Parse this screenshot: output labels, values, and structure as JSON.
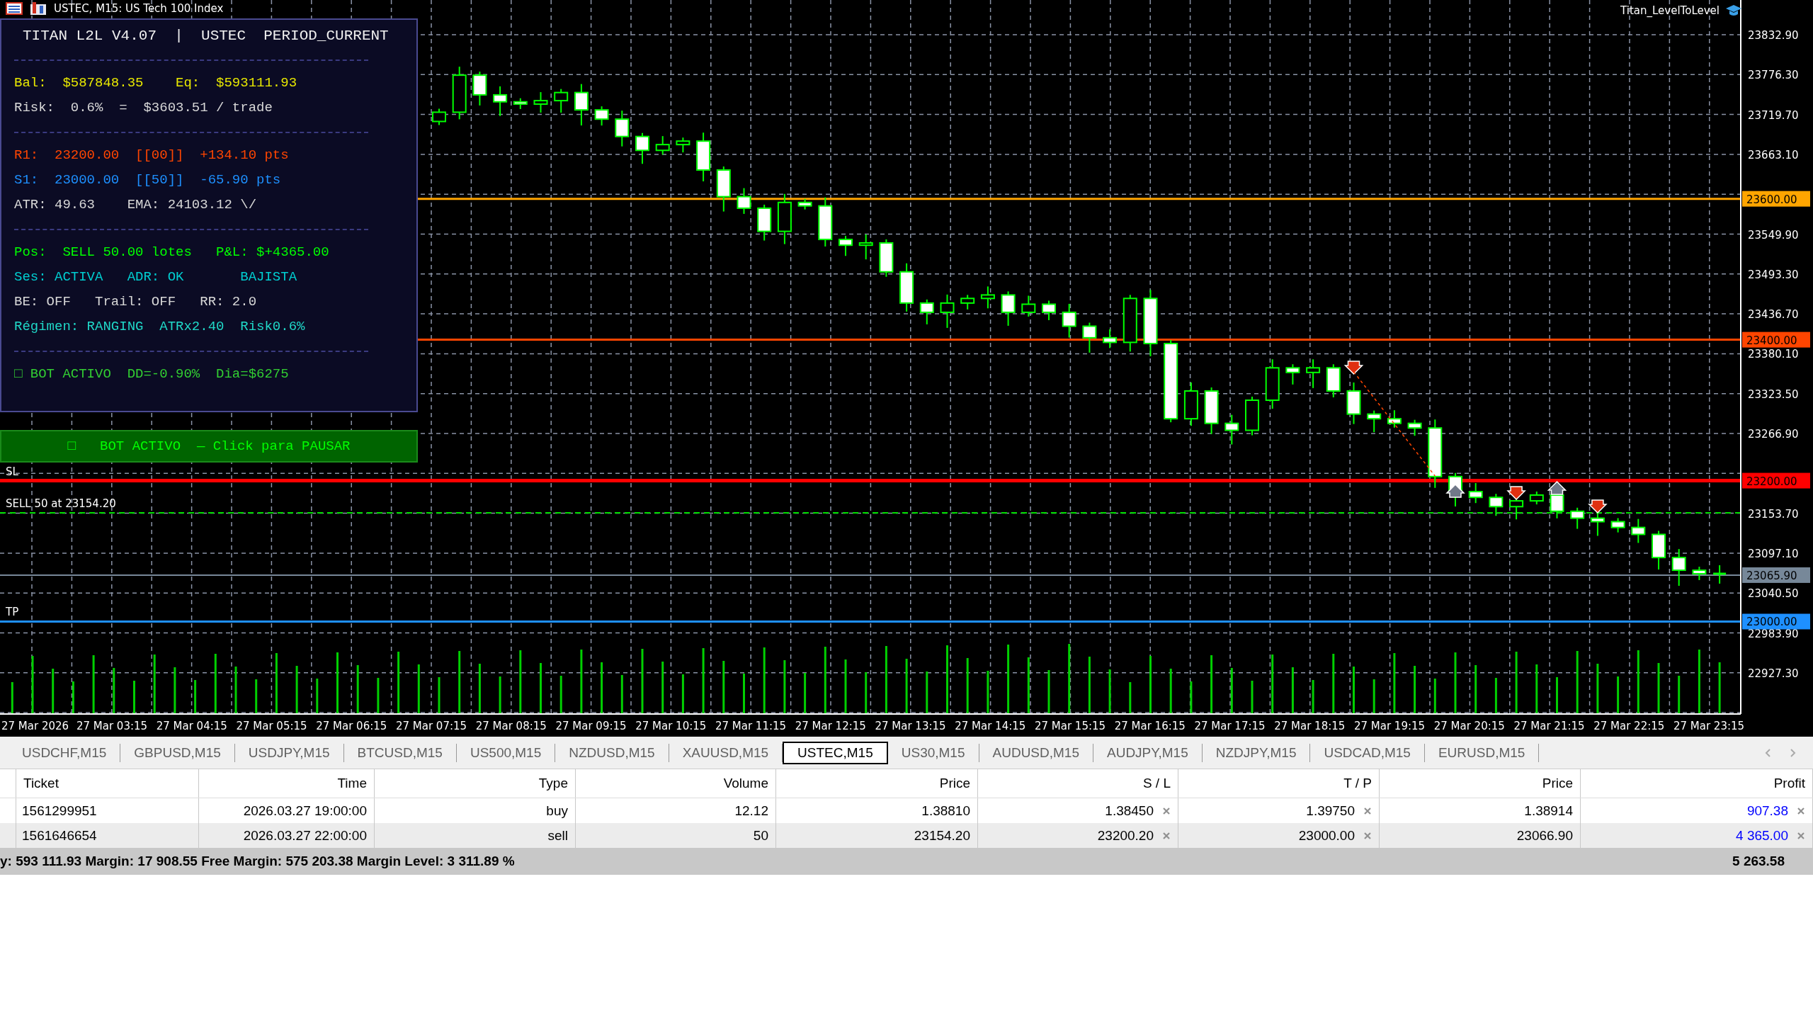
{
  "chart": {
    "title": "USTEC, M15: US Tech 100 Index",
    "indicator": "Titan_LevelToLevel",
    "price_labels": [
      "23832.90",
      "23776.30",
      "23719.70",
      "23663.10",
      "23549.90",
      "23493.30",
      "23436.70",
      "23380.10",
      "23323.50",
      "23266.90",
      "23153.70",
      "23097.10",
      "23040.50",
      "22983.90",
      "22927.30"
    ],
    "time_labels": [
      "27 Mar 2026",
      "27 Mar 03:15",
      "27 Mar 04:15",
      "27 Mar 05:15",
      "27 Mar 06:15",
      "27 Mar 07:15",
      "27 Mar 08:15",
      "27 Mar 09:15",
      "27 Mar 10:15",
      "27 Mar 11:15",
      "27 Mar 12:15",
      "27 Mar 13:15",
      "27 Mar 14:15",
      "27 Mar 15:15",
      "27 Mar 16:15",
      "27 Mar 17:15",
      "27 Mar 18:15",
      "27 Mar 19:15",
      "27 Mar 20:15",
      "27 Mar 21:15",
      "27 Mar 22:15",
      "27 Mar 23:15"
    ],
    "levels": [
      {
        "tag": "23600.00",
        "color": "#ffa500"
      },
      {
        "tag": "23400.00",
        "color": "#ff4500"
      },
      {
        "tag": "23200.00",
        "color": "#ff0000",
        "label": "SL"
      },
      {
        "tag": "23065.90",
        "color": "#778899"
      },
      {
        "tag": "23000.00",
        "color": "#1e90ff",
        "label": "TP"
      }
    ],
    "order_line": {
      "label": "SELL 50 at 23154.20"
    }
  },
  "panel": {
    "title": "TITAN L2L V4.07  |  USTEC  PERIOD_CURRENT",
    "sections": [
      [
        {
          "text": "Bal:  $587848.35    Eq:  $593111.93",
          "color": "#e8e800"
        },
        {
          "text": "Risk:  0.6%  =  $3603.51 / trade",
          "color": "#d8d8d8"
        }
      ],
      [
        {
          "text": "R1:  23200.00  [[00]]  +134.10 pts",
          "color": "#ff4500"
        },
        {
          "text": "S1:  23000.00  [[50]]  -65.90 pts",
          "color": "#1e90ff"
        },
        {
          "text": "ATR: 49.63    EMA: 24103.12 \\/",
          "color": "#d8d8d8"
        }
      ],
      [
        {
          "text": "Pos:  SELL 50.00 lotes   P&L: $+4365.00",
          "color": "#00ff00"
        },
        {
          "text": "Ses: ACTIVA   ADR: OK       BAJISTA",
          "color": "#00ced1"
        },
        {
          "text": "BE: OFF   Trail: OFF   RR: 2.0",
          "color": "#d8d8d8"
        },
        {
          "text": "Régimen: RANGING  ATRx2.40  Risk0.6%",
          "color": "#20d8c8"
        }
      ],
      [
        {
          "text": "□ BOT ACTIVO  DD=-0.90%  Dia=$6275",
          "color": "#32cd32"
        }
      ]
    ]
  },
  "bot_button": {
    "label": "□   BOT ACTIVO  — Click para PAUSAR"
  },
  "tabs": [
    {
      "label": "USDCHF,M15",
      "selected": false
    },
    {
      "label": "GBPUSD,M15",
      "selected": false
    },
    {
      "label": "USDJPY,M15",
      "selected": false
    },
    {
      "label": "BTCUSD,M15",
      "selected": false
    },
    {
      "label": "US500,M15",
      "selected": false
    },
    {
      "label": "NZDUSD,M15",
      "selected": false
    },
    {
      "label": "XAUUSD,M15",
      "selected": false
    },
    {
      "label": "USTEC,M15",
      "selected": true
    },
    {
      "label": "US30,M15",
      "selected": false
    },
    {
      "label": "AUDUSD,M15",
      "selected": false
    },
    {
      "label": "AUDJPY,M15",
      "selected": false
    },
    {
      "label": "NZDJPY,M15",
      "selected": false
    },
    {
      "label": "USDCAD,M15",
      "selected": false
    },
    {
      "label": "EURUSD,M15",
      "selected": false
    }
  ],
  "table": {
    "columns": [
      "Ticket",
      "Time",
      "Type",
      "Volume",
      "Price",
      "S / L",
      "T / P",
      "Price",
      "Profit"
    ],
    "rows": [
      [
        "1561299951",
        "2026.03.27 19:00:00",
        "buy",
        "12.12",
        "1.38810",
        "1.38450",
        "1.39750",
        "1.38914",
        "907.38"
      ],
      [
        "1561646654",
        "2026.03.27 22:00:00",
        "sell",
        "50",
        "23154.20",
        "23200.20",
        "23000.00",
        "23066.90",
        "4 365.00"
      ]
    ],
    "summary": "y: 593 111.93  Margin: 17 908.55  Free Margin: 575 203.38  Margin Level: 3 311.89 %",
    "total": "5 263.58"
  }
}
